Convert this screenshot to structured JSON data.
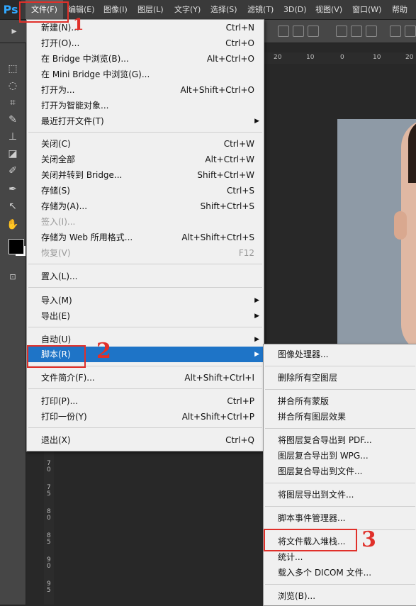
{
  "app": {
    "logo": "Ps"
  },
  "menubar": {
    "items": [
      "文件(F)",
      "编辑(E)",
      "图像(I)",
      "图层(L)",
      "文字(Y)",
      "选择(S)",
      "滤镜(T)",
      "3D(D)",
      "视图(V)",
      "窗口(W)",
      "帮助"
    ],
    "active": "文件(F)"
  },
  "rulers": {
    "top": [
      "20",
      "10",
      "0",
      "10",
      "20"
    ],
    "left": [
      "7\n0",
      "7\n5",
      "8\n0",
      "8\n5",
      "9\n0",
      "9\n5"
    ]
  },
  "file_menu": {
    "items": [
      {
        "label": "新建(N)...",
        "shortcut": "Ctrl+N"
      },
      {
        "label": "打开(O)...",
        "shortcut": "Ctrl+O"
      },
      {
        "label": "在 Bridge 中浏览(B)...",
        "shortcut": "Alt+Ctrl+O"
      },
      {
        "label": "在 Mini Bridge 中浏览(G)...",
        "shortcut": ""
      },
      {
        "label": "打开为...",
        "shortcut": "Alt+Shift+Ctrl+O"
      },
      {
        "label": "打开为智能对象...",
        "shortcut": ""
      },
      {
        "label": "最近打开文件(T)",
        "shortcut": ""
      },
      {
        "label": "关闭(C)",
        "shortcut": "Ctrl+W"
      },
      {
        "label": "关闭全部",
        "shortcut": "Alt+Ctrl+W"
      },
      {
        "label": "关闭并转到 Bridge...",
        "shortcut": "Shift+Ctrl+W"
      },
      {
        "label": "存储(S)",
        "shortcut": "Ctrl+S"
      },
      {
        "label": "存储为(A)...",
        "shortcut": "Shift+Ctrl+S"
      },
      {
        "label": "签入(I)...",
        "shortcut": ""
      },
      {
        "label": "存储为 Web 所用格式...",
        "shortcut": "Alt+Shift+Ctrl+S"
      },
      {
        "label": "恢复(V)",
        "shortcut": "F12"
      },
      {
        "label": "置入(L)...",
        "shortcut": ""
      },
      {
        "label": "导入(M)",
        "shortcut": ""
      },
      {
        "label": "导出(E)",
        "shortcut": ""
      },
      {
        "label": "自动(U)",
        "shortcut": ""
      },
      {
        "label": "脚本(R)",
        "shortcut": ""
      },
      {
        "label": "文件简介(F)...",
        "shortcut": "Alt+Shift+Ctrl+I"
      },
      {
        "label": "打印(P)...",
        "shortcut": "Ctrl+P"
      },
      {
        "label": "打印一份(Y)",
        "shortcut": "Alt+Shift+Ctrl+P"
      },
      {
        "label": "退出(X)",
        "shortcut": "Ctrl+Q"
      }
    ],
    "highlighted": "脚本(R)"
  },
  "script_menu": {
    "items": [
      "图像处理器...",
      "删除所有空图层",
      "拼合所有蒙版",
      "拼合所有图层效果",
      "将图层复合导出到 PDF...",
      "图层复合导出到 WPG...",
      "图层复合导出到文件...",
      "将图层导出到文件...",
      "脚本事件管理器...",
      "将文件载入堆栈...",
      "统计...",
      "载入多个 DICOM 文件...",
      "浏览(B)..."
    ]
  },
  "annotations": {
    "mark_1": "1",
    "mark_2": "2",
    "mark_3": "3"
  },
  "colors": {
    "highlight": "#1e74c7",
    "annotation_red": "#e0302a",
    "ps_blue": "#31a8ff"
  }
}
